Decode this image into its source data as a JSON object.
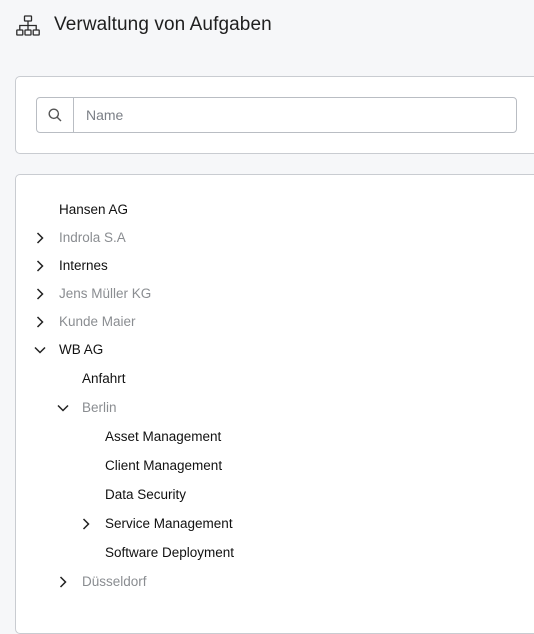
{
  "header": {
    "title": "Verwaltung von Aufgaben",
    "icon": "sitemap-icon"
  },
  "search": {
    "placeholder": "Name",
    "value": "",
    "icon": "search-icon"
  },
  "tree": {
    "items": [
      {
        "label": "Hansen AG",
        "muted": false,
        "toggle": "none"
      },
      {
        "label": "Indrola S.A",
        "muted": true,
        "toggle": "collapsed"
      },
      {
        "label": "Internes",
        "muted": false,
        "toggle": "collapsed"
      },
      {
        "label": "Jens Müller KG",
        "muted": true,
        "toggle": "collapsed"
      },
      {
        "label": "Kunde Maier",
        "muted": true,
        "toggle": "collapsed"
      },
      {
        "label": "WB AG",
        "muted": false,
        "toggle": "expanded"
      },
      {
        "label": "Anfahrt",
        "muted": false,
        "toggle": "none"
      },
      {
        "label": "Berlin",
        "muted": true,
        "toggle": "expanded"
      },
      {
        "label": "Asset Management",
        "muted": false,
        "toggle": "none"
      },
      {
        "label": "Client Management",
        "muted": false,
        "toggle": "none"
      },
      {
        "label": "Data Security",
        "muted": false,
        "toggle": "none"
      },
      {
        "label": "Service Management",
        "muted": false,
        "toggle": "collapsed"
      },
      {
        "label": "Software Deployment",
        "muted": false,
        "toggle": "none"
      },
      {
        "label": "Düsseldorf",
        "muted": true,
        "toggle": "collapsed"
      }
    ]
  }
}
